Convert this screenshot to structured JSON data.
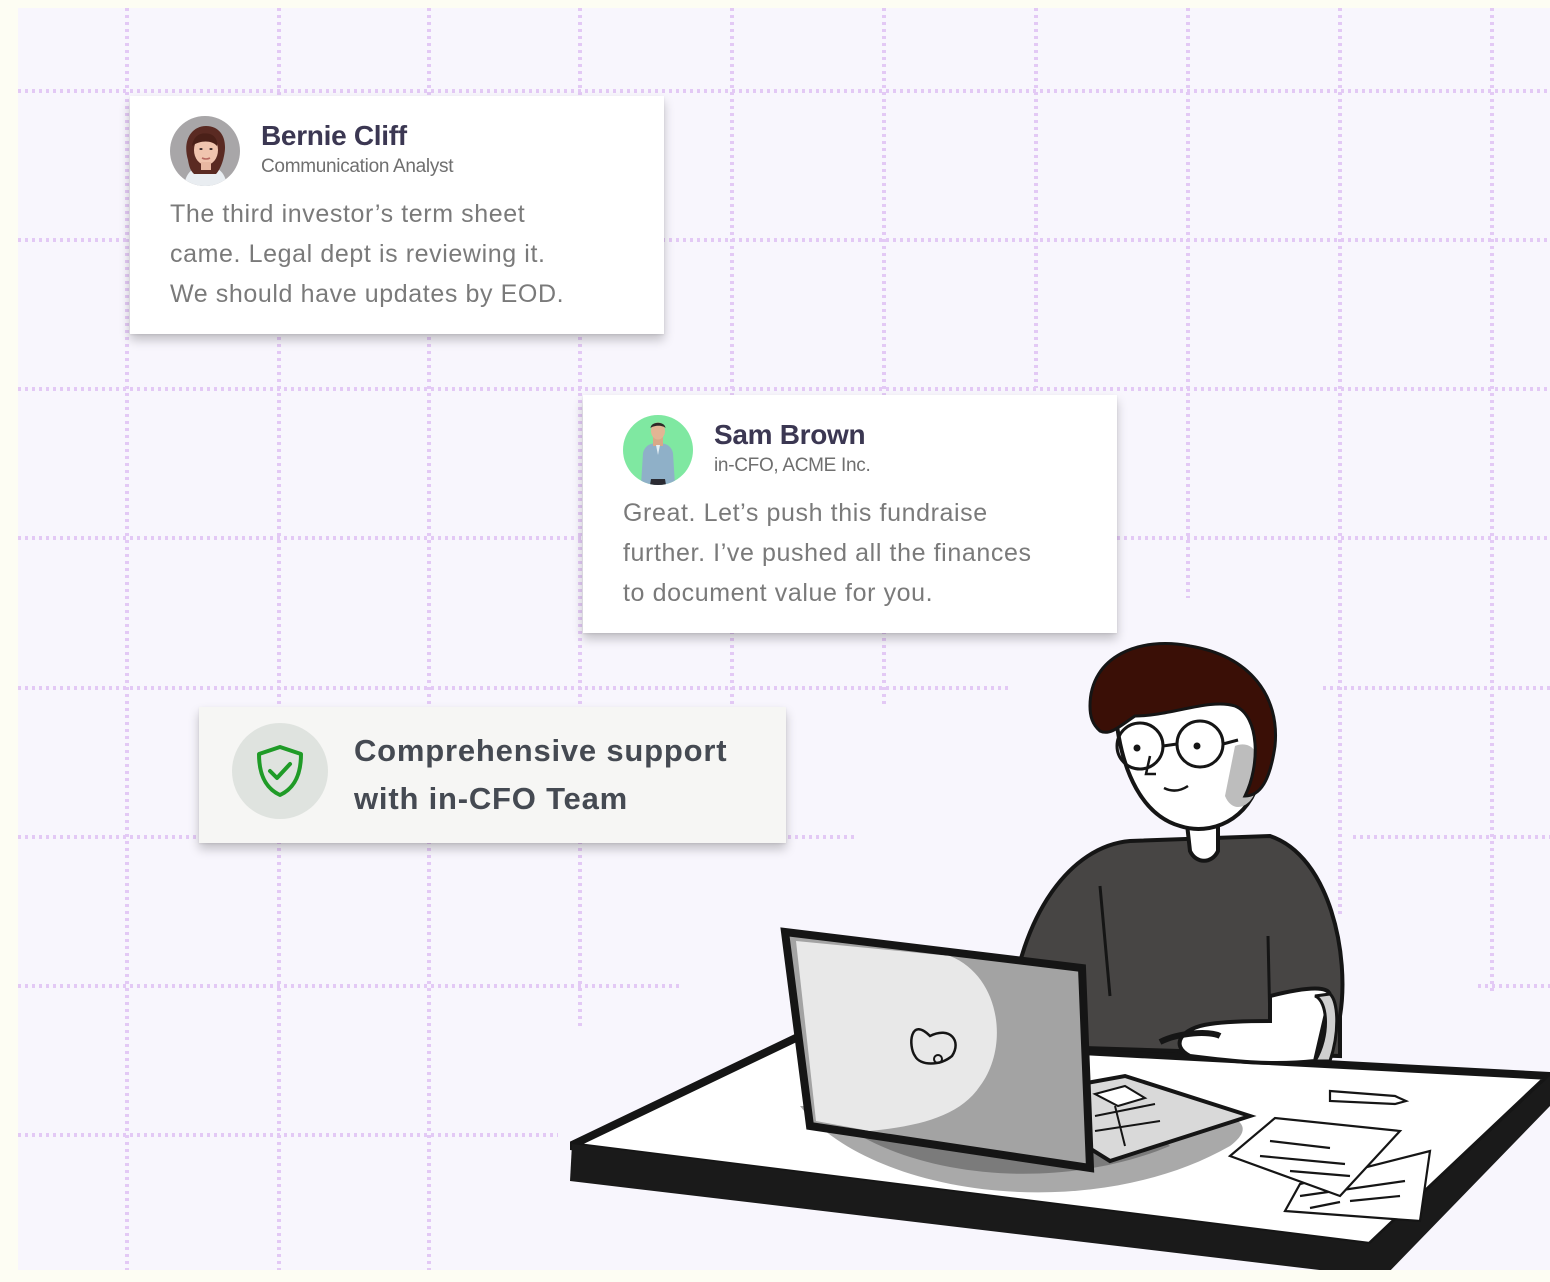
{
  "messages": [
    {
      "name": "Bernie Cliff",
      "role": "Communication Analyst",
      "lines": [
        "The third investor’s term sheet",
        "came. Legal dept is reviewing it.",
        "We should have updates by EOD."
      ]
    },
    {
      "name": "Sam Brown",
      "role": "in-CFO, ACME Inc.",
      "lines": [
        "Great. Let’s push this fundraise",
        "further. I’ve pushed all the finances",
        "to document value for you."
      ]
    }
  ],
  "feature": {
    "icon": "shield-check-icon",
    "lines": [
      "Comprehensive support",
      "with in-CFO Team"
    ]
  },
  "colors": {
    "grid": "#e3c9f5",
    "background": "#f8f6fd",
    "name": "#3b3752",
    "message": "#7a7a7a",
    "shield": "#1f9b27",
    "avatar_green": "#7fe8a1"
  }
}
